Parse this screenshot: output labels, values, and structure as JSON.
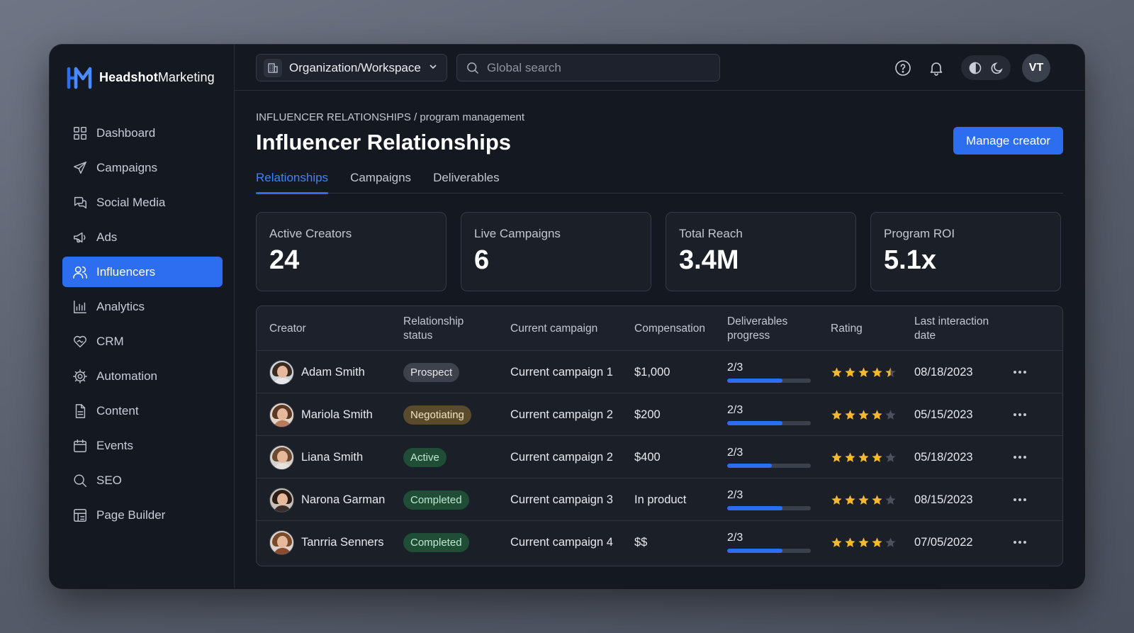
{
  "brand": {
    "name_bold": "Headshot",
    "name_rest": "Marketing",
    "accent": "#2d6ef0"
  },
  "sidebar": {
    "items": [
      {
        "label": "Dashboard",
        "icon": "grid-icon",
        "active": false
      },
      {
        "label": "Campaigns",
        "icon": "send-icon",
        "active": false
      },
      {
        "label": "Social Media",
        "icon": "chat-bubbles-icon",
        "active": false
      },
      {
        "label": "Ads",
        "icon": "megaphone-icon",
        "active": false
      },
      {
        "label": "Influencers",
        "icon": "users-icon",
        "active": true
      },
      {
        "label": "Analytics",
        "icon": "bar-chart-icon",
        "active": false
      },
      {
        "label": "CRM",
        "icon": "heart-handshake-icon",
        "active": false
      },
      {
        "label": "Automation",
        "icon": "gear-icon",
        "active": false
      },
      {
        "label": "Content",
        "icon": "document-icon",
        "active": false
      },
      {
        "label": "Events",
        "icon": "calendar-icon",
        "active": false
      },
      {
        "label": "SEO",
        "icon": "search-icon",
        "active": false
      },
      {
        "label": "Page Builder",
        "icon": "layout-icon",
        "active": false
      }
    ]
  },
  "topbar": {
    "workspace": "Organization/Workspace",
    "search_placeholder": "Global search",
    "avatar_initials": "VT"
  },
  "header": {
    "breadcrumb": "INFLUENCER RELATIONSHIPS / program management",
    "title": "Influencer Relationships",
    "primary_button": "Manage creator"
  },
  "tabs": [
    {
      "label": "Relationships",
      "active": true
    },
    {
      "label": "Campaigns",
      "active": false
    },
    {
      "label": "Deliverables",
      "active": false
    }
  ],
  "stats": [
    {
      "label": "Active Creators",
      "value": "24"
    },
    {
      "label": "Live Campaigns",
      "value": "6"
    },
    {
      "label": "Total Reach",
      "value": "3.4M"
    },
    {
      "label": "Program ROI",
      "value": "5.1x"
    }
  ],
  "table": {
    "columns": [
      "Creator",
      "Relationship status",
      "Current campaign",
      "Compensation",
      "Deliverables progress",
      "Rating",
      "Last interaction date"
    ],
    "rows": [
      {
        "creator": "Adam Smith",
        "status": "Prospect",
        "status_kind": "prospect",
        "campaign": "Current campaign 1",
        "compensation": "$1,000",
        "progress": "2/3",
        "progress_fraction": 0.66,
        "rating": 4.5,
        "date": "08/18/2023"
      },
      {
        "creator": "Mariola Smith",
        "status": "Negotiating",
        "status_kind": "negotiating",
        "campaign": "Current campaign 2",
        "compensation": "$200",
        "progress": "2/3",
        "progress_fraction": 0.66,
        "rating": 4,
        "date": "05/15/2023"
      },
      {
        "creator": "Liana Smith",
        "status": "Active",
        "status_kind": "active",
        "campaign": "Current campaign 2",
        "compensation": "$400",
        "progress": "2/3",
        "progress_fraction": 0.53,
        "rating": 4,
        "date": "05/18/2023"
      },
      {
        "creator": "Narona Garman",
        "status": "Completed",
        "status_kind": "completed",
        "campaign": "Current campaign 3",
        "compensation": "In product",
        "progress": "2/3",
        "progress_fraction": 0.66,
        "rating": 4,
        "date": "08/15/2023"
      },
      {
        "creator": "Tanrria Senners",
        "status": "Completed",
        "status_kind": "completed",
        "campaign": "Current campaign 4",
        "compensation": "$$",
        "progress": "2/3",
        "progress_fraction": 0.66,
        "rating": 4,
        "date": "07/05/2022"
      }
    ]
  },
  "colors": {
    "star_filled": "#f5b82e",
    "star_empty": "#4a505c"
  }
}
